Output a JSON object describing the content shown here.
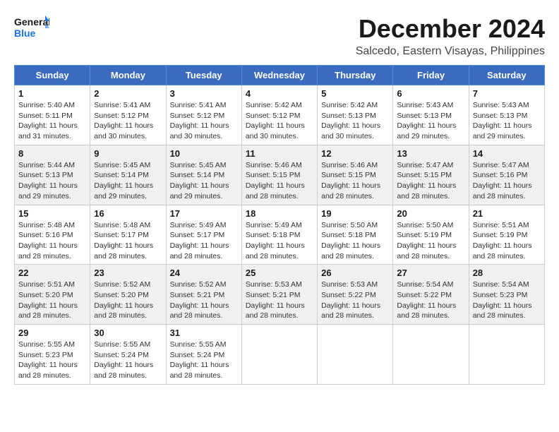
{
  "logo": {
    "line1": "General",
    "line2": "Blue"
  },
  "title": "December 2024",
  "location": "Salcedo, Eastern Visayas, Philippines",
  "header_color": "#3a6bbf",
  "days_of_week": [
    "Sunday",
    "Monday",
    "Tuesday",
    "Wednesday",
    "Thursday",
    "Friday",
    "Saturday"
  ],
  "weeks": [
    [
      {
        "day": "1",
        "sunrise": "5:40 AM",
        "sunset": "5:11 PM",
        "daylight": "11 hours and 31 minutes."
      },
      {
        "day": "2",
        "sunrise": "5:41 AM",
        "sunset": "5:12 PM",
        "daylight": "11 hours and 30 minutes."
      },
      {
        "day": "3",
        "sunrise": "5:41 AM",
        "sunset": "5:12 PM",
        "daylight": "11 hours and 30 minutes."
      },
      {
        "day": "4",
        "sunrise": "5:42 AM",
        "sunset": "5:12 PM",
        "daylight": "11 hours and 30 minutes."
      },
      {
        "day": "5",
        "sunrise": "5:42 AM",
        "sunset": "5:13 PM",
        "daylight": "11 hours and 30 minutes."
      },
      {
        "day": "6",
        "sunrise": "5:43 AM",
        "sunset": "5:13 PM",
        "daylight": "11 hours and 29 minutes."
      },
      {
        "day": "7",
        "sunrise": "5:43 AM",
        "sunset": "5:13 PM",
        "daylight": "11 hours and 29 minutes."
      }
    ],
    [
      {
        "day": "8",
        "sunrise": "5:44 AM",
        "sunset": "5:13 PM",
        "daylight": "11 hours and 29 minutes."
      },
      {
        "day": "9",
        "sunrise": "5:45 AM",
        "sunset": "5:14 PM",
        "daylight": "11 hours and 29 minutes."
      },
      {
        "day": "10",
        "sunrise": "5:45 AM",
        "sunset": "5:14 PM",
        "daylight": "11 hours and 29 minutes."
      },
      {
        "day": "11",
        "sunrise": "5:46 AM",
        "sunset": "5:15 PM",
        "daylight": "11 hours and 28 minutes."
      },
      {
        "day": "12",
        "sunrise": "5:46 AM",
        "sunset": "5:15 PM",
        "daylight": "11 hours and 28 minutes."
      },
      {
        "day": "13",
        "sunrise": "5:47 AM",
        "sunset": "5:15 PM",
        "daylight": "11 hours and 28 minutes."
      },
      {
        "day": "14",
        "sunrise": "5:47 AM",
        "sunset": "5:16 PM",
        "daylight": "11 hours and 28 minutes."
      }
    ],
    [
      {
        "day": "15",
        "sunrise": "5:48 AM",
        "sunset": "5:16 PM",
        "daylight": "11 hours and 28 minutes."
      },
      {
        "day": "16",
        "sunrise": "5:48 AM",
        "sunset": "5:17 PM",
        "daylight": "11 hours and 28 minutes."
      },
      {
        "day": "17",
        "sunrise": "5:49 AM",
        "sunset": "5:17 PM",
        "daylight": "11 hours and 28 minutes."
      },
      {
        "day": "18",
        "sunrise": "5:49 AM",
        "sunset": "5:18 PM",
        "daylight": "11 hours and 28 minutes."
      },
      {
        "day": "19",
        "sunrise": "5:50 AM",
        "sunset": "5:18 PM",
        "daylight": "11 hours and 28 minutes."
      },
      {
        "day": "20",
        "sunrise": "5:50 AM",
        "sunset": "5:19 PM",
        "daylight": "11 hours and 28 minutes."
      },
      {
        "day": "21",
        "sunrise": "5:51 AM",
        "sunset": "5:19 PM",
        "daylight": "11 hours and 28 minutes."
      }
    ],
    [
      {
        "day": "22",
        "sunrise": "5:51 AM",
        "sunset": "5:20 PM",
        "daylight": "11 hours and 28 minutes."
      },
      {
        "day": "23",
        "sunrise": "5:52 AM",
        "sunset": "5:20 PM",
        "daylight": "11 hours and 28 minutes."
      },
      {
        "day": "24",
        "sunrise": "5:52 AM",
        "sunset": "5:21 PM",
        "daylight": "11 hours and 28 minutes."
      },
      {
        "day": "25",
        "sunrise": "5:53 AM",
        "sunset": "5:21 PM",
        "daylight": "11 hours and 28 minutes."
      },
      {
        "day": "26",
        "sunrise": "5:53 AM",
        "sunset": "5:22 PM",
        "daylight": "11 hours and 28 minutes."
      },
      {
        "day": "27",
        "sunrise": "5:54 AM",
        "sunset": "5:22 PM",
        "daylight": "11 hours and 28 minutes."
      },
      {
        "day": "28",
        "sunrise": "5:54 AM",
        "sunset": "5:23 PM",
        "daylight": "11 hours and 28 minutes."
      }
    ],
    [
      {
        "day": "29",
        "sunrise": "5:55 AM",
        "sunset": "5:23 PM",
        "daylight": "11 hours and 28 minutes."
      },
      {
        "day": "30",
        "sunrise": "5:55 AM",
        "sunset": "5:24 PM",
        "daylight": "11 hours and 28 minutes."
      },
      {
        "day": "31",
        "sunrise": "5:55 AM",
        "sunset": "5:24 PM",
        "daylight": "11 hours and 28 minutes."
      },
      null,
      null,
      null,
      null
    ]
  ]
}
